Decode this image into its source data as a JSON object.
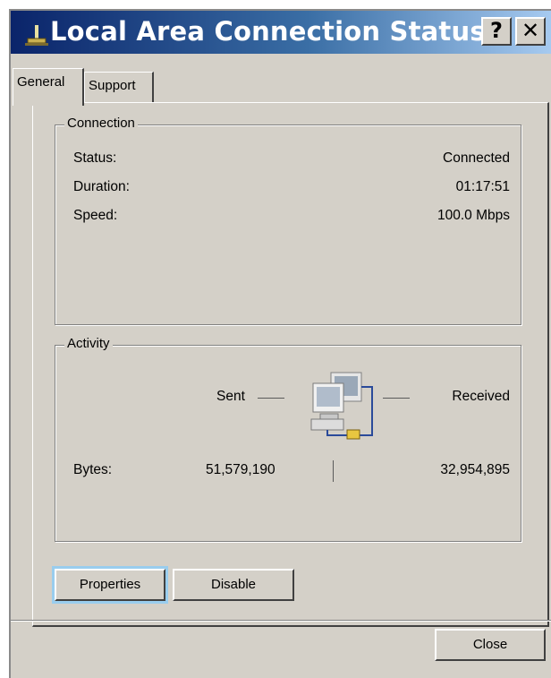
{
  "window": {
    "title": "Local Area Connection Status",
    "help_button": "?",
    "close_button": "✕"
  },
  "tabs": [
    {
      "label": "General",
      "active": true
    },
    {
      "label": "Support",
      "active": false
    }
  ],
  "connection": {
    "legend": "Connection",
    "status_label": "Status:",
    "status_value": "Connected",
    "duration_label": "Duration:",
    "duration_value": "01:17:51",
    "speed_label": "Speed:",
    "speed_value": "100.0 Mbps"
  },
  "activity": {
    "legend": "Activity",
    "sent_label": "Sent",
    "received_label": "Received",
    "bytes_label": "Bytes:",
    "bytes_sent": "51,579,190",
    "bytes_received": "32,954,895"
  },
  "buttons": {
    "properties": "Properties",
    "disable": "Disable",
    "close": "Close"
  },
  "icons": {
    "title": "network-connection-icon",
    "activity": "network-computers-icon"
  }
}
